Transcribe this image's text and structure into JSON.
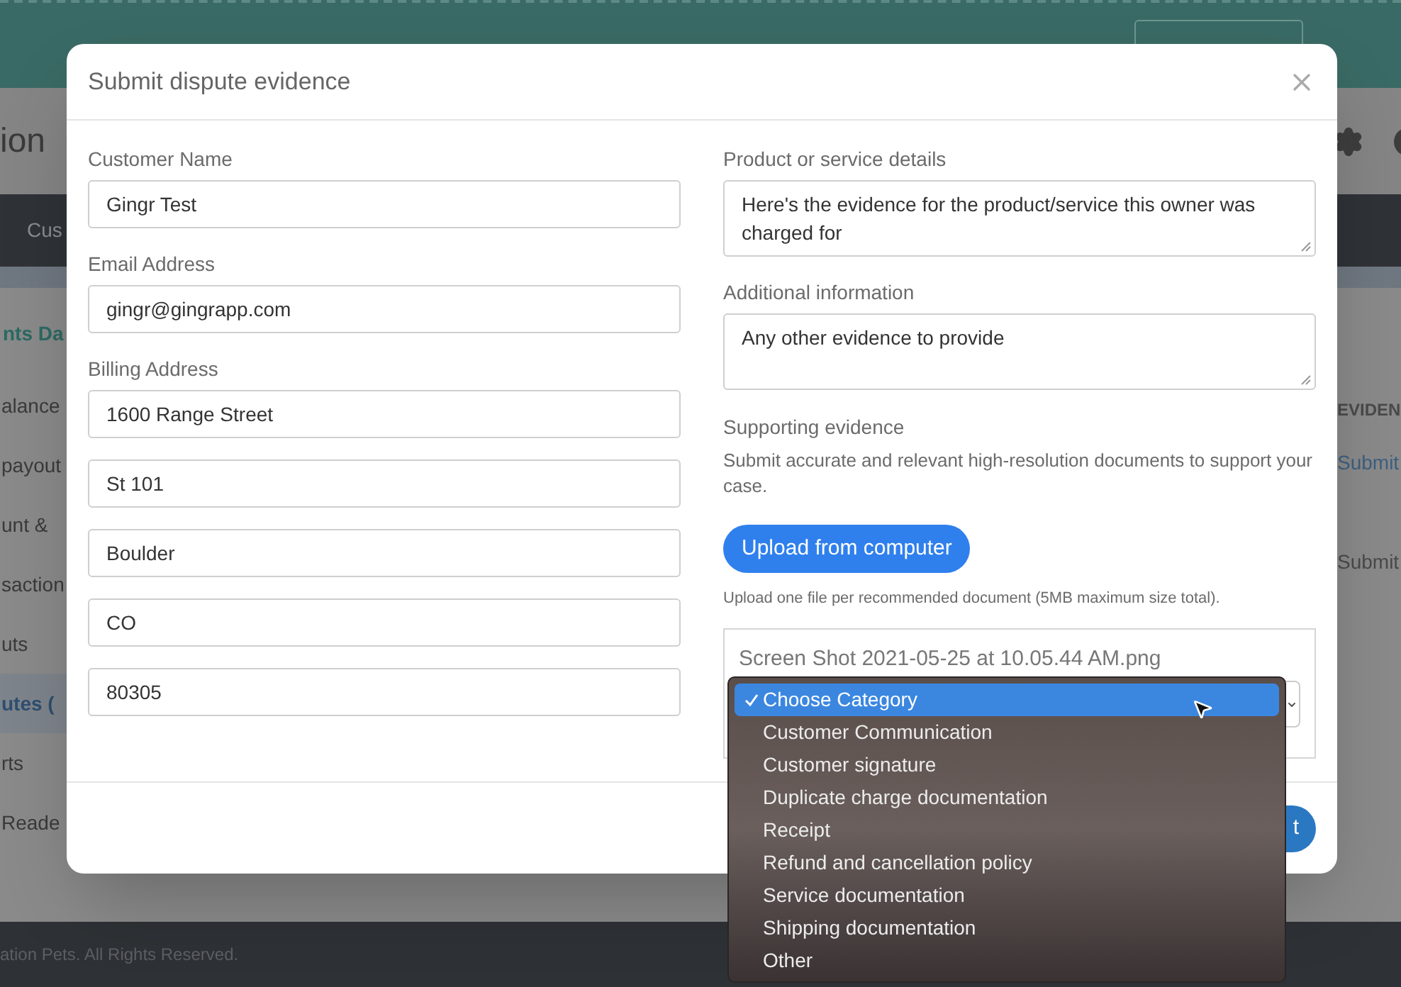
{
  "header": {
    "title": "ion"
  },
  "nav": {
    "items": [
      "Cus"
    ]
  },
  "sidebar": {
    "heading": "nts Da",
    "items": [
      {
        "label": "alance",
        "selected": false
      },
      {
        "label": "payout",
        "selected": false
      },
      {
        "label": "unt &",
        "selected": false
      },
      {
        "label": "saction",
        "selected": false
      },
      {
        "label": "uts",
        "selected": false
      },
      {
        "label": "utes (",
        "selected": true
      },
      {
        "label": "rts",
        "selected": false
      },
      {
        "label": "Reade",
        "selected": false
      }
    ]
  },
  "table": {
    "column_header": "EVIDEN",
    "rows": [
      {
        "action": "Submit",
        "kind": "link"
      },
      {
        "action": "Submit",
        "kind": "text"
      }
    ]
  },
  "footer": "ation Pets. All Rights Reserved.",
  "modal": {
    "title": "Submit dispute evidence",
    "customer_name": {
      "label": "Customer Name",
      "value": "Gingr Test"
    },
    "email": {
      "label": "Email Address",
      "value": "gingr@gingrapp.com"
    },
    "billing_address": {
      "label": "Billing Address",
      "lines": [
        "1600 Range Street",
        "St 101",
        "Boulder",
        "CO",
        "80305"
      ]
    },
    "product_details": {
      "label": "Product or service details",
      "value": "Here's the evidence for the product/service this owner was charged for"
    },
    "additional_info": {
      "label": "Additional information",
      "value": "Any other evidence to provide"
    },
    "supporting_evidence": {
      "label": "Supporting evidence",
      "description": "Submit accurate and relevant high-resolution documents to support your case.",
      "upload_button": "Upload from computer",
      "note": "Upload one file per recommended document (5MB maximum size total).",
      "file_name": "Screen Shot 2021-05-25 at 10.05.44 AM.png"
    },
    "footer_button": "t"
  },
  "category_menu": {
    "items": [
      {
        "label": "Choose Category",
        "selected": true
      },
      {
        "label": "Customer Communication",
        "selected": false
      },
      {
        "label": "Customer signature",
        "selected": false
      },
      {
        "label": "Duplicate charge documentation",
        "selected": false
      },
      {
        "label": "Receipt",
        "selected": false
      },
      {
        "label": "Refund and cancellation policy",
        "selected": false
      },
      {
        "label": "Service documentation",
        "selected": false
      },
      {
        "label": "Shipping documentation",
        "selected": false
      },
      {
        "label": "Other",
        "selected": false
      }
    ]
  }
}
